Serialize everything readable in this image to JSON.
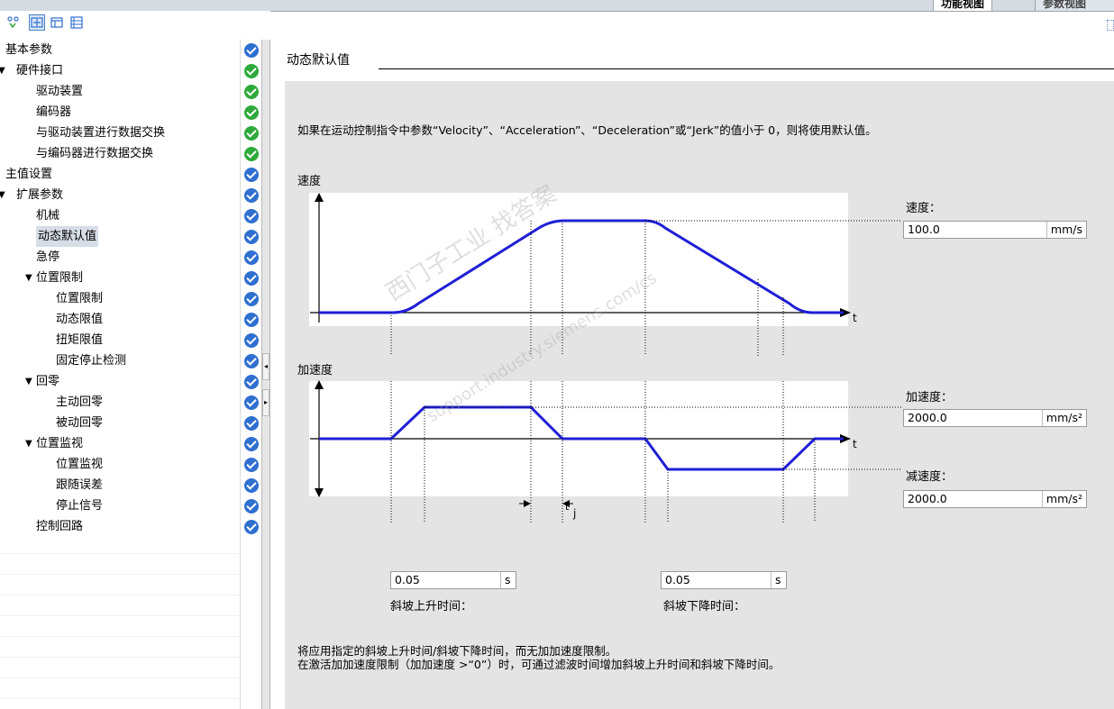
{
  "tabs": {
    "active": "功能视图",
    "inactive": "参数视图"
  },
  "toolbar": {
    "icons": [
      "view-toggle-icon",
      "expand-icon",
      "collapse-icon",
      "list-icon"
    ]
  },
  "tree": {
    "items": [
      {
        "label": "基本参数",
        "level": 0,
        "arrow": "",
        "status": "blue"
      },
      {
        "label": "硬件接口",
        "level": 0,
        "arrow": "▼",
        "status": "green"
      },
      {
        "label": "驱动装置",
        "level": 1,
        "arrow": "",
        "status": "green"
      },
      {
        "label": "编码器",
        "level": 1,
        "arrow": "",
        "status": "green"
      },
      {
        "label": "与驱动装置进行数据交换",
        "level": 1,
        "arrow": "",
        "status": "green"
      },
      {
        "label": "与编码器进行数据交换",
        "level": 1,
        "arrow": "",
        "status": "green"
      },
      {
        "label": "主值设置",
        "level": 0,
        "arrow": "",
        "status": "blue"
      },
      {
        "label": "扩展参数",
        "level": 0,
        "arrow": "▼",
        "status": "blue"
      },
      {
        "label": "机械",
        "level": 1,
        "arrow": "",
        "status": "blue"
      },
      {
        "label": "动态默认值",
        "level": 1,
        "arrow": "",
        "status": "blue",
        "selected": true
      },
      {
        "label": "急停",
        "level": 1,
        "arrow": "",
        "status": "blue"
      },
      {
        "label": "位置限制",
        "level": 1,
        "arrow": "▼",
        "status": "blue"
      },
      {
        "label": "位置限制",
        "level": 2,
        "arrow": "",
        "status": "blue"
      },
      {
        "label": "动态限值",
        "level": 2,
        "arrow": "",
        "status": "blue"
      },
      {
        "label": "扭矩限值",
        "level": 2,
        "arrow": "",
        "status": "blue"
      },
      {
        "label": "固定停止检测",
        "level": 2,
        "arrow": "",
        "status": "blue"
      },
      {
        "label": "回零",
        "level": 1,
        "arrow": "▼",
        "status": "blue"
      },
      {
        "label": "主动回零",
        "level": 2,
        "arrow": "",
        "status": "blue"
      },
      {
        "label": "被动回零",
        "level": 2,
        "arrow": "",
        "status": "blue"
      },
      {
        "label": "位置监视",
        "level": 1,
        "arrow": "▼",
        "status": "blue"
      },
      {
        "label": "位置监视",
        "level": 2,
        "arrow": "",
        "status": "blue"
      },
      {
        "label": "跟随误差",
        "level": 2,
        "arrow": "",
        "status": "blue"
      },
      {
        "label": "停止信号",
        "level": 2,
        "arrow": "",
        "status": "blue"
      },
      {
        "label": "控制回路",
        "level": 1,
        "arrow": "",
        "status": "blue"
      }
    ]
  },
  "main": {
    "section_title": "动态默认值",
    "description": "如果在运动控制指令中参数“Velocity”、“Acceleration”、“Deceleration”或“Jerk”的值小于 0，则将使用默认值。",
    "velocity_chart_label": "速度",
    "accel_chart_label": "加速度",
    "t_axis": "t",
    "tj_label": "t",
    "tj_sub": "j",
    "velocity": {
      "label": "速度：",
      "value": "100.0",
      "unit": "mm/s"
    },
    "acceleration": {
      "label": "加速度：",
      "value": "2000.0",
      "unit": "mm/s²"
    },
    "deceleration": {
      "label": "减速度：",
      "value": "2000.0",
      "unit": "mm/s²"
    },
    "ramp_up": {
      "value": "0.05",
      "unit": "s",
      "label": "斜坡上升时间："
    },
    "ramp_down": {
      "value": "0.05",
      "unit": "s",
      "label": "斜坡下降时间："
    },
    "footer_line1": "将应用指定的斜坡上升时间/斜坡下降时间，而无加加速度限制。",
    "footer_line2": "在激活加加速度限制（加加速度 >“0”）时，可通过滤波时间增加斜坡上升时间和斜坡下降时间。",
    "watermark1": "西门子工业 找答案",
    "watermark2": "support.industry.siemens.com/cs"
  },
  "colors": {
    "curve": "#1f1fd6",
    "check_green": "#2eaa3a",
    "check_blue": "#2f6fd0",
    "panel_bg": "#e4e4e4"
  }
}
